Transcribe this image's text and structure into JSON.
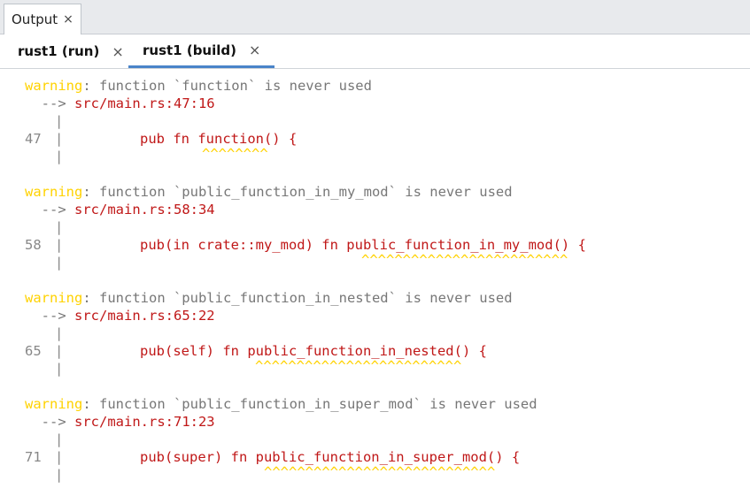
{
  "panel": {
    "output_tab": "Output",
    "close_glyph": "×"
  },
  "tabs": [
    {
      "label": "rust1 (run)",
      "close": "×"
    },
    {
      "label": "rust1 (build)",
      "close": "×"
    }
  ],
  "warnings": [
    {
      "level": "warning",
      "message": ": function `function` is never used",
      "arrow": "  --> ",
      "location": "src/main.rs:47:16",
      "line_no": "47",
      "code": "pub fn function() {",
      "underline": "^^^^^^^^"
    },
    {
      "level": "warning",
      "message": ": function `public_function_in_my_mod` is never used",
      "arrow": "  --> ",
      "location": "src/main.rs:58:34",
      "line_no": "58",
      "code": "pub(in crate::my_mod) fn public_function_in_my_mod() {",
      "underline": "^^^^^^^^^^^^^^^^^^^^^^^^^"
    },
    {
      "level": "warning",
      "message": ": function `public_function_in_nested` is never used",
      "arrow": "  --> ",
      "location": "src/main.rs:65:22",
      "line_no": "65",
      "code": "pub(self) fn public_function_in_nested() {",
      "underline": "^^^^^^^^^^^^^^^^^^^^^^^^^"
    },
    {
      "level": "warning",
      "message": ": function `public_function_in_super_mod` is never used",
      "arrow": "  --> ",
      "location": "src/main.rs:71:23",
      "line_no": "71",
      "code": "pub(super) fn public_function_in_super_mod() {",
      "underline": "^^^^^^^^^^^^^^^^^^^^^^^^^^^^"
    }
  ],
  "colors": {
    "warning": "#ffd200",
    "path": "#c01818",
    "code": "#c01818",
    "message": "#777777",
    "active_tab_underline": "#4a84c9"
  }
}
